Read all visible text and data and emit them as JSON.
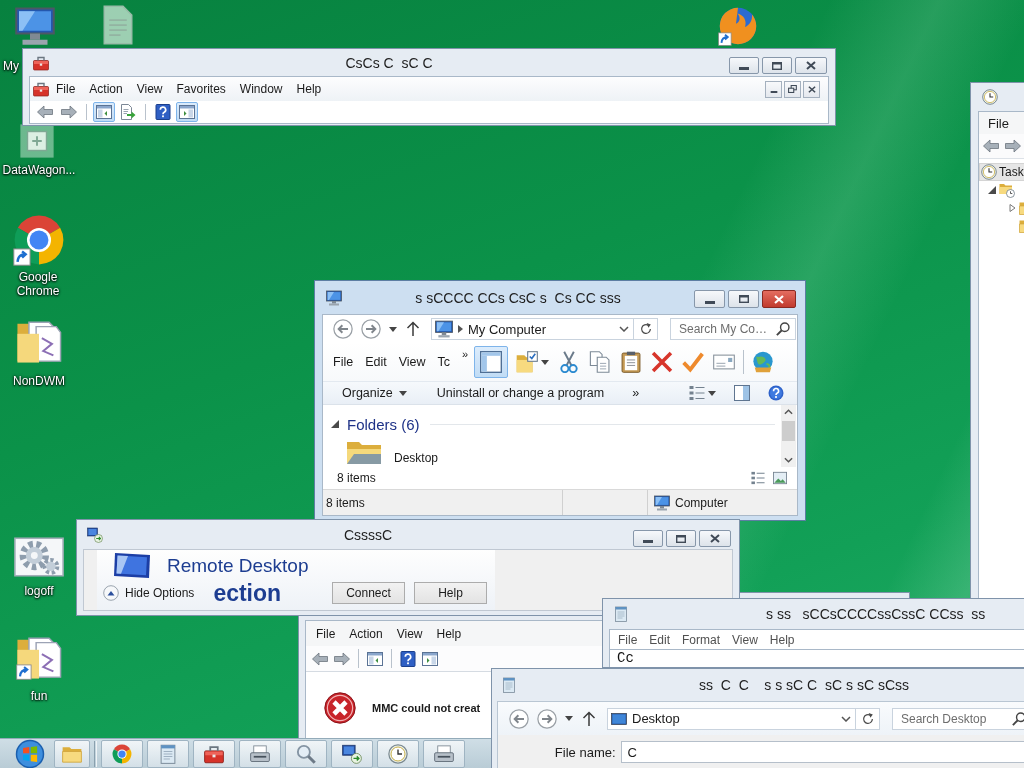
{
  "desktop_icons": [
    {
      "kind": "computer",
      "label": "My",
      "shortcut": false
    },
    {
      "kind": "document",
      "shortcut": false
    },
    {
      "kind": "browser",
      "shortcut": true
    },
    {
      "kind": "app",
      "label": "DataWagon...",
      "shortcut": false
    },
    {
      "kind": "chrome",
      "label": "Google Chrome",
      "shortcut": true
    },
    {
      "kind": "folder",
      "label": "NonDWM",
      "shortcut": false
    },
    {
      "kind": "gear",
      "label": "logoff",
      "shortcut": false
    },
    {
      "kind": "folder",
      "label": "fun",
      "shortcut": true
    }
  ],
  "mmc_window": {
    "title": "CsCs C  sC C",
    "active": false,
    "menu": [
      "File",
      "Action",
      "View",
      "Favorites",
      "Window",
      "Help"
    ],
    "toolbar_groups": [
      [
        {
          "kind": "back",
          "pressed": false
        },
        {
          "kind": "forward",
          "pressed": false
        }
      ],
      [
        {
          "kind": "tree",
          "pressed": true
        },
        {
          "kind": "export",
          "pressed": false
        }
      ],
      [
        {
          "kind": "help",
          "pressed": false
        },
        {
          "kind": "actions",
          "pressed": true
        }
      ]
    ]
  },
  "task_window": {
    "menu": [
      "File"
    ],
    "tree": [
      {
        "label": "Task",
        "selected": true,
        "children": [
          {
            "expanded": true,
            "selected": false,
            "children": [
              {
                "expanded": false,
                "selected": false
              },
              {
                "selected": false
              }
            ]
          }
        ]
      }
    ]
  },
  "explorer_window": {
    "title": "s sCCCC CCs CsC s  Cs CC sss",
    "active": true,
    "address": "My Computer",
    "search": {
      "placeholder": "Search My Co…"
    },
    "menu": [
      "File",
      "Edit",
      "View",
      "Tc"
    ],
    "menu_overflow": "»",
    "toolbar_groups": [
      [
        {
          "kind": "layout",
          "pressed": true
        },
        {
          "kind": "folders",
          "pressed": false
        },
        {
          "kind": "cut",
          "pressed": false
        },
        {
          "kind": "copy",
          "pressed": false
        },
        {
          "kind": "paste",
          "pressed": false
        },
        {
          "kind": "delete",
          "pressed": false
        },
        {
          "kind": "check",
          "pressed": false
        },
        {
          "kind": "card",
          "pressed": false
        }
      ],
      [
        {
          "kind": "globe",
          "pressed": false
        }
      ]
    ],
    "commands": [
      {
        "label": "Organize",
        "dropdown": true
      },
      {
        "label": "Uninstall or change a program",
        "dropdown": false
      }
    ],
    "command_overflow": "»",
    "groups": [
      {
        "label": "Folders (6)",
        "expanded": true,
        "items": [
          {
            "label": "Desktop",
            "selected": false
          }
        ]
      }
    ],
    "item_count": "8 items",
    "status": {
      "count": "8 items",
      "location": "Computer"
    }
  },
  "mmc_error_window": {
    "menu": [
      "File",
      "Action",
      "View",
      "Help"
    ],
    "toolbar_groups": [
      [
        {
          "kind": "back",
          "pressed": false
        },
        {
          "kind": "forward",
          "pressed": false
        }
      ],
      [
        {
          "kind": "tree",
          "pressed": false
        }
      ],
      [
        {
          "kind": "help",
          "pressed": false
        },
        {
          "kind": "actions",
          "pressed": false
        }
      ]
    ],
    "message": "MMC could not creat"
  },
  "remote_desktop_window": {
    "title": "CssssC",
    "active": false,
    "heading": "Remote Desktop",
    "heading_rest": "ection",
    "options_toggle": "Hide Options",
    "buttons": [
      "Connect",
      "Help"
    ]
  },
  "notepad_window": {
    "title": "s ss   sCCsCCCCssCssC CCss  ss",
    "menu": [
      "File",
      "Edit",
      "Format",
      "View",
      "Help"
    ],
    "text": "Cc"
  },
  "save_dialog": {
    "title": "ss  C  C    s s sC C  sC s sC sCss",
    "location": "Desktop",
    "search": {
      "placeholder": "Search Desktop"
    },
    "file_name": {
      "label": "File name:",
      "value": "C"
    }
  }
}
